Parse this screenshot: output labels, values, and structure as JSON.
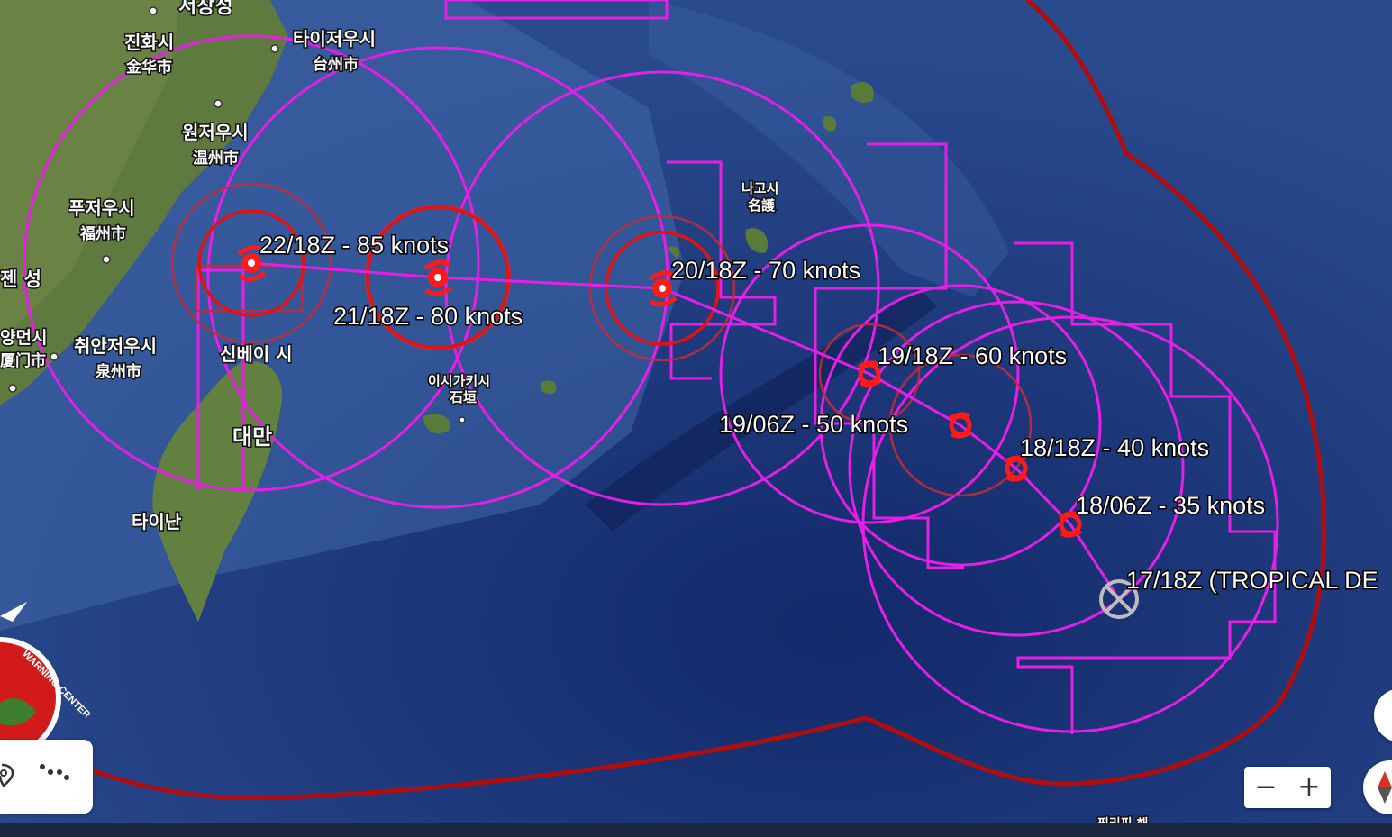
{
  "map": {
    "place_labels": [
      "서장성",
      "진화시",
      "金华市",
      "타이저우시",
      "台州市",
      "원저우시",
      "温州市",
      "푸저우시",
      "福州市",
      "젠 성",
      "양먼시",
      "厦门市",
      "취안저우시",
      "泉州市",
      "신베이 시",
      "대만",
      "타이난",
      "이시가키시",
      "石垣",
      "나고시",
      "名護",
      "필리핀 해"
    ],
    "colors": {
      "ocean": "#1f3a78",
      "cone": "#e61ee6",
      "danger_area": "#b00e0e",
      "wind_radius": "#c42a3a",
      "storm_symbol": "#ff1a1a",
      "track": "#e61ee6"
    }
  },
  "forecast": {
    "points": [
      {
        "label": "17/18Z (TROPICAL DE",
        "status": "tropical-depression"
      },
      {
        "label": "18/06Z - 35 knots",
        "knots": 35
      },
      {
        "label": "18/18Z - 40 knots",
        "knots": 40
      },
      {
        "label": "19/06Z - 50 knots",
        "knots": 50
      },
      {
        "label": "19/18Z - 60 knots",
        "knots": 60
      },
      {
        "label": "20/18Z - 70 knots",
        "knots": 70
      },
      {
        "label": "21/18Z - 80 knots",
        "knots": 80
      },
      {
        "label": "22/18Z - 85 knots",
        "knots": 85
      }
    ]
  },
  "controls": {
    "zoom_out": "−",
    "zoom_in": "+",
    "location_icon": "map-pin-icon",
    "track_icon": "route-dots-icon",
    "compass_icon": "compass-icon",
    "badge_text": "WARNING CENTER"
  }
}
